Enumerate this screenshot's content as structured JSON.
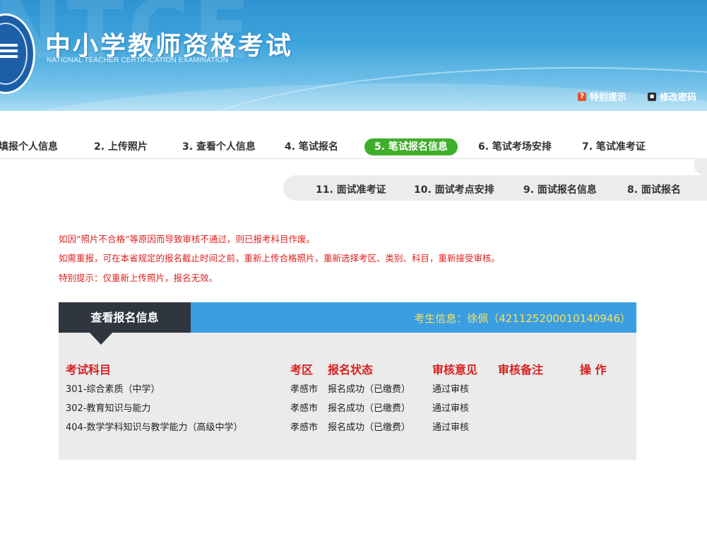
{
  "header": {
    "title": "中小学教师资格考试",
    "subtitle": "NATIONAL TEACHER CERTIFICATION EXAMINATION",
    "watermark": "NTCE",
    "links": [
      {
        "icon": "question-icon",
        "label": "特别提示"
      },
      {
        "icon": "lock-icon",
        "label": "修改密码"
      }
    ]
  },
  "steps_row1": [
    {
      "label": "填报个人信息"
    },
    {
      "label": "2. 上传照片"
    },
    {
      "label": "3. 查看个人信息"
    },
    {
      "label": "4. 笔试报名"
    },
    {
      "label": "5. 笔试报名信息",
      "active": true
    },
    {
      "label": "6. 笔试考场安排"
    },
    {
      "label": "7. 笔试准考证"
    }
  ],
  "steps_row2": [
    {
      "label": "11. 面试准考证"
    },
    {
      "label": "10. 面试考点安排"
    },
    {
      "label": "9. 面试报名信息"
    },
    {
      "label": "8. 面试报名"
    }
  ],
  "notices": [
    "如因“照片不合格”等原因而导致审核不通过，则已报考科目作废。",
    "如需重报，可在本省规定的报名截止时间之前，重新上传合格照片，重新选择考区、类别、科目，重新接受审核。",
    "特别提示：仅重新上传照片，报名无效。"
  ],
  "panel": {
    "tab_label": "查看报名信息",
    "student_info": "考生信息：徐佩（421125200010140946）",
    "columns": [
      "考试科目",
      "考区",
      "报名状态",
      "审核意见",
      "审核备注",
      "操 作"
    ],
    "rows": [
      {
        "subject": "301-综合素质（中学）",
        "area": "孝感市",
        "status": "报名成功（已缴费）",
        "review": "通过审核",
        "remark": "",
        "action": ""
      },
      {
        "subject": "302-教育知识与能力",
        "area": "孝感市",
        "status": "报名成功（已缴费）",
        "review": "通过审核",
        "remark": "",
        "action": ""
      },
      {
        "subject": "404-数学学科知识与教学能力（高级中学）",
        "area": "孝感市",
        "status": "报名成功（已缴费）",
        "review": "通过审核",
        "remark": "",
        "action": ""
      }
    ]
  },
  "colors": {
    "header_blue": "#2f93d1",
    "active_step": "#3fae2a",
    "notice_red": "#e0201f",
    "panel_blue": "#3b9de2",
    "panel_tab": "#2f3640",
    "student_info": "#f5e35a",
    "column_header": "#d7201f"
  }
}
